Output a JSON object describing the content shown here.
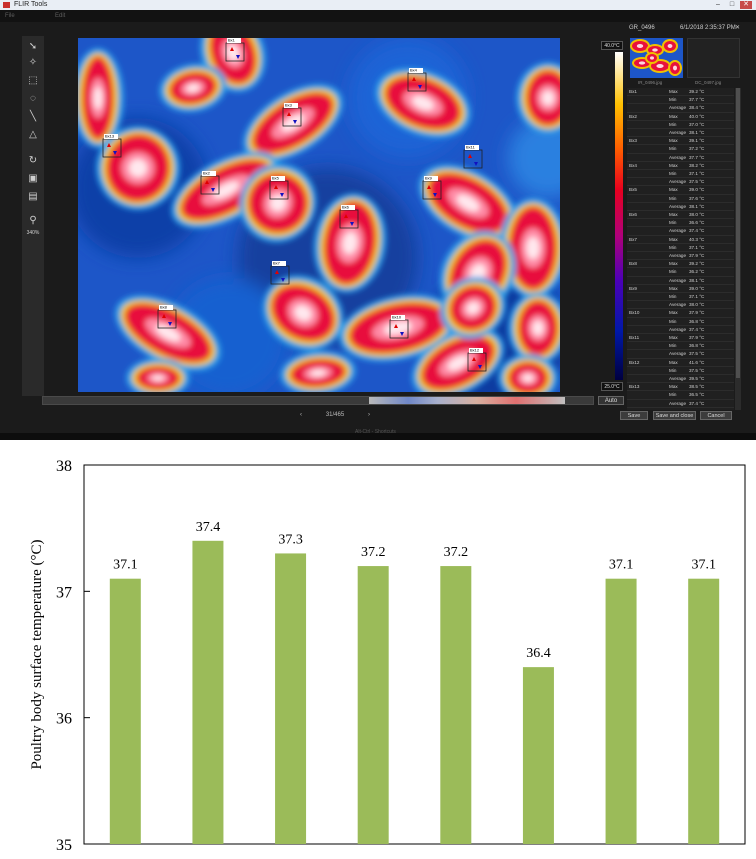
{
  "window": {
    "title": "FLIR Tools",
    "buttons": [
      "–",
      "□",
      "✕"
    ]
  },
  "menu": [
    "File",
    "Edit"
  ],
  "toolbar": {
    "tools": [
      {
        "icon": "arrow-pointer-icon",
        "glyph": "➘"
      },
      {
        "icon": "spot-meter-icon",
        "glyph": "✧"
      },
      {
        "icon": "box-tool-icon",
        "glyph": "⬚"
      },
      {
        "icon": "ellipse-tool-icon",
        "glyph": "◌"
      },
      {
        "icon": "line-tool-icon",
        "glyph": "╲"
      },
      {
        "icon": "triangle-tool-icon",
        "glyph": "△"
      },
      {
        "icon": "rotate-icon",
        "glyph": "↻"
      },
      {
        "icon": "palette-icon",
        "glyph": "▣"
      },
      {
        "icon": "layer-icon",
        "glyph": "▤"
      },
      {
        "icon": "zoom-icon",
        "glyph": "⚲"
      }
    ],
    "zoom": "340%"
  },
  "image": {
    "name": "GR_0496",
    "datetime": "6/1/2018 2:35:37 PM",
    "scale_max": "40.0°C",
    "scale_min": "25.0°C",
    "auto_label": "Auto",
    "page": "31/465",
    "thumb1_label": "IR_0496.jpg",
    "thumb2_label": "DC_0497.jpg",
    "footer_text": "Alt-Ctrl - Shortcuts"
  },
  "actions": {
    "save": "Save",
    "save_close": "Save and close",
    "cancel": "Cancel"
  },
  "boxes": [
    "Bx1",
    "Bx2",
    "Bx3",
    "Bx4",
    "Bx5",
    "Bx6",
    "Bx7",
    "Bx8",
    "Bx9",
    "Bx10",
    "Bx11",
    "Bx12",
    "Bx13"
  ],
  "measurements": [
    [
      "Bx1",
      "Max",
      "39.2 °C"
    ],
    [
      "",
      "Min",
      "37.7 °C"
    ],
    [
      "",
      "Average",
      "38.4 °C"
    ],
    [
      "Bx2",
      "Max",
      "40.0 °C"
    ],
    [
      "",
      "Min",
      "37.0 °C"
    ],
    [
      "",
      "Average",
      "38.1 °C"
    ],
    [
      "Bx3",
      "Max",
      "39.1 °C"
    ],
    [
      "",
      "Min",
      "37.2 °C"
    ],
    [
      "",
      "Average",
      "37.7 °C"
    ],
    [
      "Bx4",
      "Max",
      "38.2 °C"
    ],
    [
      "",
      "Min",
      "37.1 °C"
    ],
    [
      "",
      "Average",
      "37.5 °C"
    ],
    [
      "Bx5",
      "Max",
      "39.0 °C"
    ],
    [
      "",
      "Min",
      "37.6 °C"
    ],
    [
      "",
      "Average",
      "38.1 °C"
    ],
    [
      "Bx6",
      "Max",
      "38.0 °C"
    ],
    [
      "",
      "Min",
      "36.6 °C"
    ],
    [
      "",
      "Average",
      "37.4 °C"
    ],
    [
      "Bx7",
      "Max",
      "40.3 °C"
    ],
    [
      "",
      "Min",
      "37.1 °C"
    ],
    [
      "",
      "Average",
      "37.9 °C"
    ],
    [
      "Bx8",
      "Max",
      "39.2 °C"
    ],
    [
      "",
      "Min",
      "36.2 °C"
    ],
    [
      "",
      "Average",
      "38.1 °C"
    ],
    [
      "Bx9",
      "Max",
      "39.0 °C"
    ],
    [
      "",
      "Min",
      "37.1 °C"
    ],
    [
      "",
      "Average",
      "38.0 °C"
    ],
    [
      "Bx10",
      "Max",
      "37.9 °C"
    ],
    [
      "",
      "Min",
      "36.8 °C"
    ],
    [
      "",
      "Average",
      "37.4 °C"
    ],
    [
      "Bx11",
      "Max",
      "37.9 °C"
    ],
    [
      "",
      "Min",
      "36.8 °C"
    ],
    [
      "",
      "Average",
      "37.5 °C"
    ],
    [
      "Bx12",
      "Max",
      "41.6 °C"
    ],
    [
      "",
      "Min",
      "37.5 °C"
    ],
    [
      "",
      "Average",
      "39.5 °C"
    ],
    [
      "Bx13",
      "Max",
      "38.5 °C"
    ],
    [
      "",
      "Min",
      "36.5 °C"
    ],
    [
      "",
      "Average",
      "37.4 °C"
    ]
  ],
  "chart_data": {
    "type": "bar",
    "categories": [
      "",
      "",
      "",
      "",
      "",
      "",
      "",
      ""
    ],
    "values": [
      37.1,
      37.4,
      37.3,
      37.2,
      37.2,
      36.4,
      37.1,
      37.1
    ],
    "data_labels": [
      "37.1",
      "37.4",
      "37.3",
      "37.2",
      "37.2",
      "36.4",
      "37.1",
      "37.1"
    ],
    "ylabel": "Poultry body surface temperature (°C)",
    "ylim": [
      35,
      38
    ],
    "yticks": [
      "35",
      "36",
      "37",
      "38"
    ],
    "bar_color": "#9bbb59",
    "grid": false
  }
}
